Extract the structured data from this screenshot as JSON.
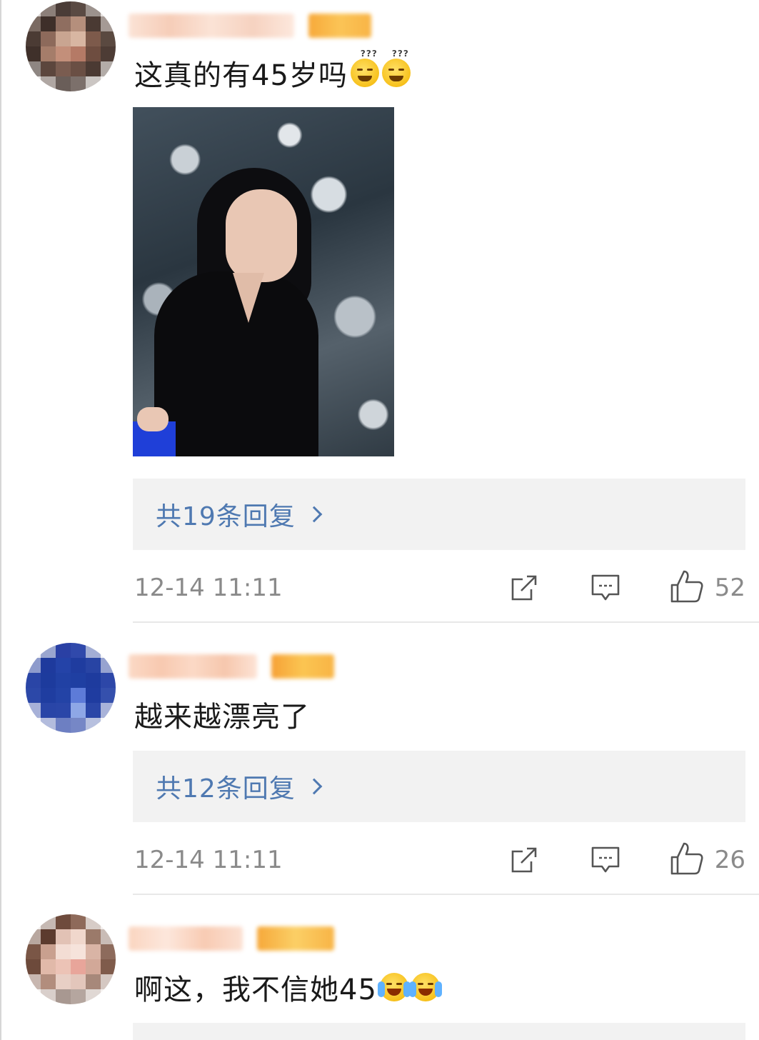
{
  "comments": [
    {
      "text": "这真的有45岁吗",
      "emojis": [
        "thinking-grin-emoji",
        "thinking-grin-emoji"
      ],
      "replies_label": "共19条回复",
      "time": "12-14 11:11",
      "likes": "52"
    },
    {
      "text": "越来越漂亮了",
      "emojis": [],
      "replies_label": "共12条回复",
      "time": "12-14 11:11",
      "likes": "26"
    },
    {
      "text": "啊这，我不信她45",
      "emojis": [
        "crying-laughing-emoji",
        "crying-laughing-emoji"
      ]
    }
  ],
  "colors": {
    "reply_link": "#4f79b1",
    "meta_gray": "#8a8a8a",
    "reply_box_bg": "#f2f2f2",
    "vip_badge": "#f5a623"
  }
}
